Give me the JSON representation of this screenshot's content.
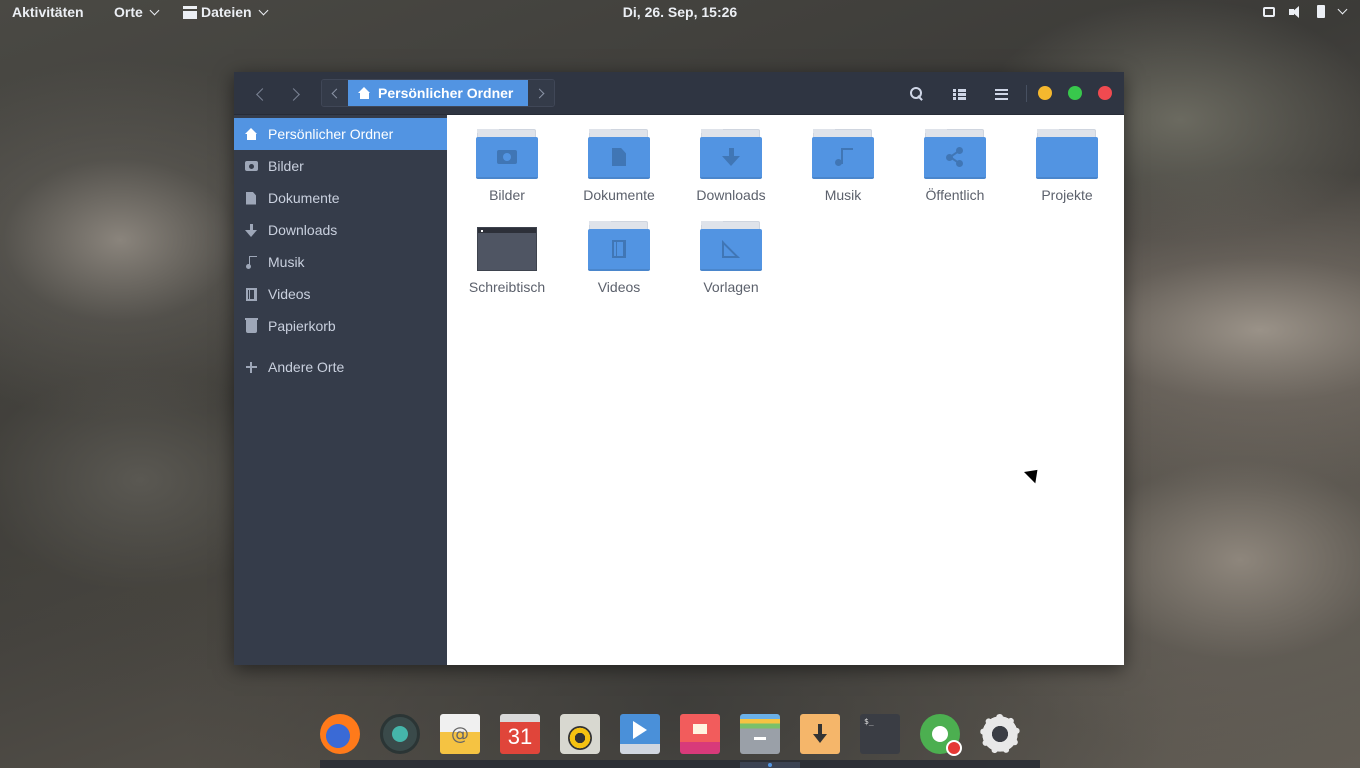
{
  "topbar": {
    "activities": "Aktivitäten",
    "places": "Orte",
    "app_menu": "Dateien",
    "clock": "Di, 26. Sep, 15:26"
  },
  "window": {
    "path_label": "Persönlicher Ordner",
    "controls": {
      "minimize_color": "#f5b82e",
      "maximize_color": "#38c84c",
      "close_color": "#f04a50"
    },
    "accent": "#5294e2"
  },
  "sidebar": {
    "items": [
      {
        "label": "Persönlicher Ordner",
        "icon": "home-icon",
        "active": true
      },
      {
        "label": "Bilder",
        "icon": "camera-icon"
      },
      {
        "label": "Dokumente",
        "icon": "document-icon"
      },
      {
        "label": "Downloads",
        "icon": "download-icon"
      },
      {
        "label": "Musik",
        "icon": "music-icon"
      },
      {
        "label": "Videos",
        "icon": "film-icon"
      },
      {
        "label": "Papierkorb",
        "icon": "trash-icon"
      }
    ],
    "other_places": "Andere Orte"
  },
  "files": [
    {
      "label": "Bilder",
      "icon": "pictures-folder-icon"
    },
    {
      "label": "Dokumente",
      "icon": "documents-folder-icon"
    },
    {
      "label": "Downloads",
      "icon": "downloads-folder-icon"
    },
    {
      "label": "Musik",
      "icon": "music-folder-icon"
    },
    {
      "label": "Öffentlich",
      "icon": "public-folder-icon"
    },
    {
      "label": "Projekte",
      "icon": "folder-icon"
    },
    {
      "label": "Schreibtisch",
      "icon": "desktop-folder-icon"
    },
    {
      "label": "Videos",
      "icon": "videos-folder-icon"
    },
    {
      "label": "Vorlagen",
      "icon": "templates-folder-icon"
    }
  ],
  "dock": {
    "items": [
      {
        "icon": "firefox-icon"
      },
      {
        "icon": "gitkraken-icon"
      },
      {
        "icon": "mail-icon"
      },
      {
        "icon": "calendar-icon",
        "text": "31"
      },
      {
        "icon": "rhythmbox-icon"
      },
      {
        "icon": "video-player-icon"
      },
      {
        "icon": "image-viewer-icon"
      },
      {
        "icon": "file-manager-icon"
      },
      {
        "icon": "download-manager-icon"
      },
      {
        "icon": "terminal-icon",
        "text": "$_"
      },
      {
        "icon": "gnome-tweaks-icon"
      },
      {
        "icon": "settings-icon"
      }
    ]
  }
}
